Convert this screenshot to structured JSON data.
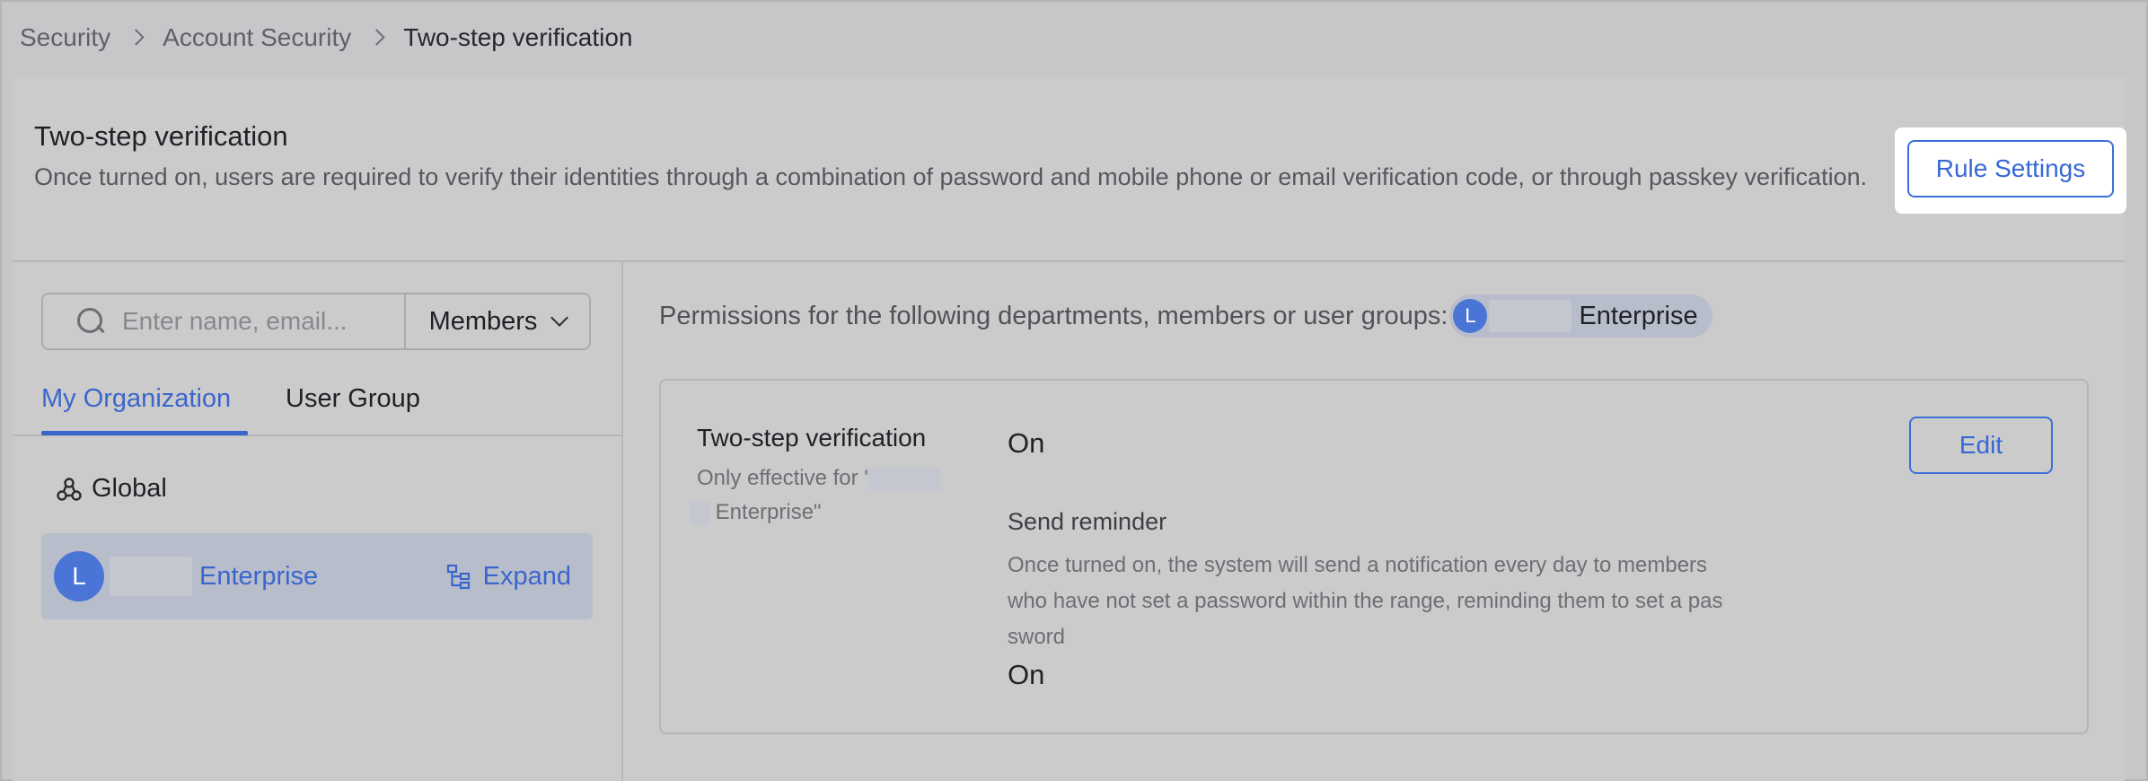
{
  "breadcrumb": {
    "items": [
      "Security",
      "Account Security",
      "Two-step verification"
    ]
  },
  "header": {
    "title": "Two-step verification",
    "description": "Once turned on, users are required to verify their identities through a combination of password and mobile phone or email verification code, or through passkey verification.",
    "rule_settings_label": "Rule Settings"
  },
  "left_panel": {
    "search_placeholder": "Enter name, email...",
    "scope_selected": "Members",
    "tabs": [
      {
        "label": "My Organization",
        "active": true
      },
      {
        "label": "User Group",
        "active": false
      }
    ],
    "global_label": "Global",
    "org_row": {
      "avatar_letter": "L",
      "name": "Enterprise",
      "expand_label": "Expand"
    }
  },
  "right_panel": {
    "permissions_text": "Permissions for the following departments, members or user groups:",
    "chip": {
      "avatar_letter": "L",
      "name": "Enterprise"
    },
    "setting": {
      "title": "Two-step verification",
      "subtitle_prefix": "Only effective for '",
      "subtitle_suffix": "Enterprise\"",
      "status": "On",
      "edit_label": "Edit",
      "reminder_title": "Send reminder",
      "reminder_desc": "Once turned on, the system will send a notification every day to members who have not set a password within the range, reminding them to set a password",
      "reminder_status": "On"
    }
  },
  "colors": {
    "accent": "#3a66cc",
    "highlight": "#ffffff"
  },
  "icons": [
    "search-icon",
    "chevron-down-icon",
    "global-icon",
    "tree-icon",
    "chevron-right-icon"
  ]
}
